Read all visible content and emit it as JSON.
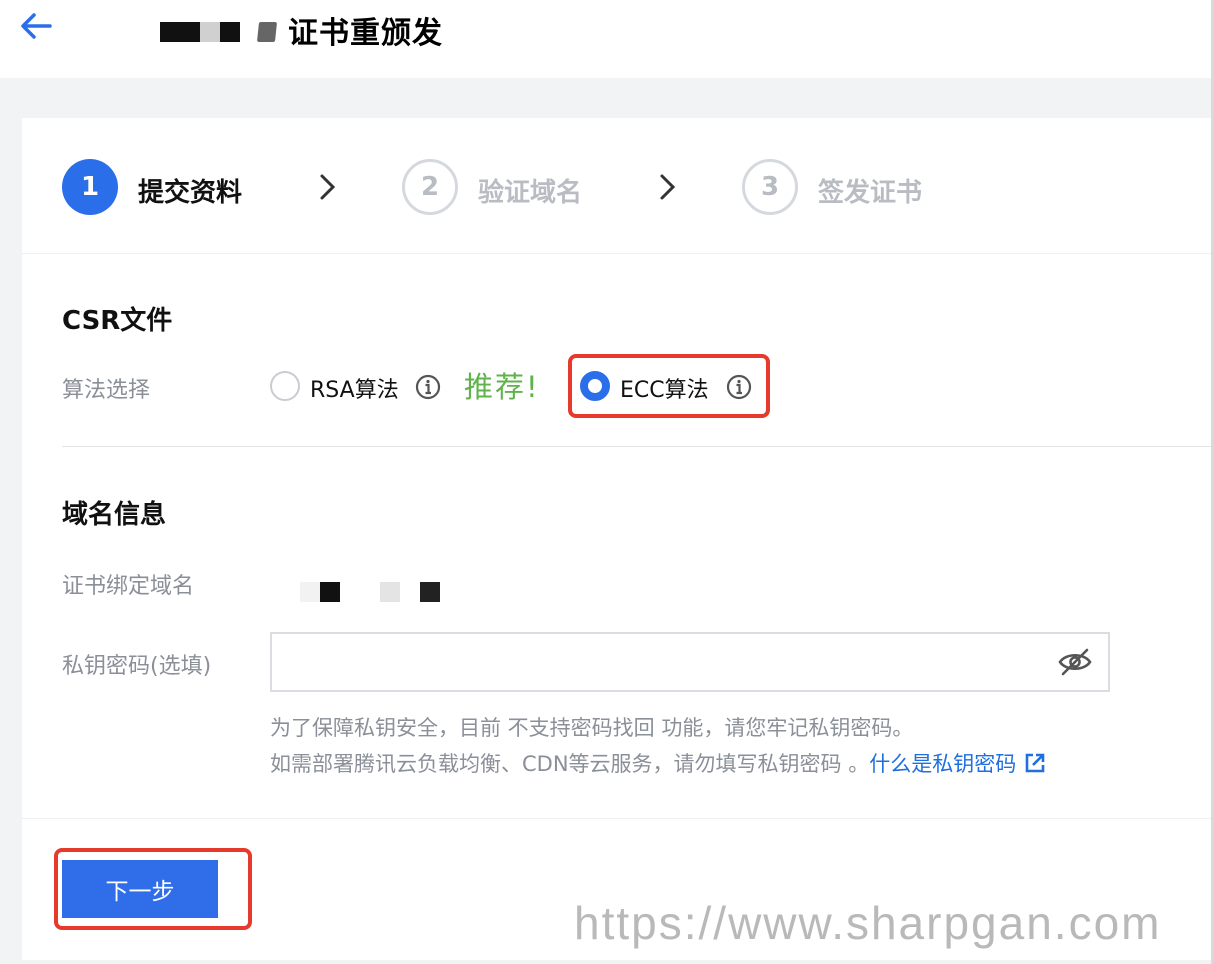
{
  "header": {
    "title": "证书重颁发",
    "back_icon": "back-arrow-icon"
  },
  "steps": [
    {
      "number": "1",
      "label": "提交资料",
      "state": "active"
    },
    {
      "number": "2",
      "label": "验证域名",
      "state": "inactive"
    },
    {
      "number": "3",
      "label": "签发证书",
      "state": "inactive"
    }
  ],
  "csr": {
    "section_title": "CSR文件",
    "algorithm_label": "算法选择",
    "options": [
      {
        "label": "RSA算法",
        "selected": false
      },
      {
        "label": "ECC算法",
        "selected": true
      }
    ],
    "recommend_text": "推荐!"
  },
  "domain": {
    "section_title": "域名信息",
    "bound_domain_label": "证书绑定域名",
    "private_key_label": "私钥密码(选填)",
    "private_key_value": "",
    "hint_line1": "为了保障私钥安全，目前 不支持密码找回 功能，请您牢记私钥密码。",
    "hint_line2": "如需部署腾讯云负载均衡、CDN等云服务，请勿填写私钥密码 。",
    "hint_link": "什么是私钥密码"
  },
  "footer": {
    "next_label": "下一步"
  },
  "watermark": "https://www.sharpgan.com",
  "colors": {
    "primary": "#2b6ee9",
    "recommend": "#5fb34a",
    "highlight": "#e53a2c",
    "link": "#1f6fe0"
  }
}
